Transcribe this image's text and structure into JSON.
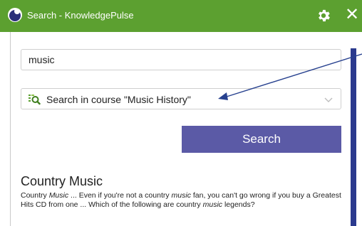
{
  "window": {
    "title": "Search - KnowledgePulse",
    "icons": {
      "logo": "app-logo-icon",
      "settings": "gear-icon",
      "close": "close-icon"
    },
    "close_glyph": "✕"
  },
  "search": {
    "query_value": "music",
    "scope_label": "Search in course \"Music History\"",
    "scope_icon": "search-tree-icon",
    "button_label": "Search"
  },
  "results": [
    {
      "title": "Country Music",
      "snippet_parts": [
        {
          "text": "Country ",
          "italic": false
        },
        {
          "text": "Music",
          "italic": true
        },
        {
          "text": " ... Even if you're not a country ",
          "italic": false
        },
        {
          "text": "music",
          "italic": true
        },
        {
          "text": " fan, you can't go wrong if you buy a Greatest Hits CD from one ... Which of the following are country ",
          "italic": false
        },
        {
          "text": "music",
          "italic": true
        },
        {
          "text": " legends?",
          "italic": false
        }
      ]
    }
  ],
  "colors": {
    "titlebar": "#5ca030",
    "button": "#5b5aa6",
    "scrollbar": "#2b3a8e",
    "annotation_arrow": "#27418f"
  }
}
